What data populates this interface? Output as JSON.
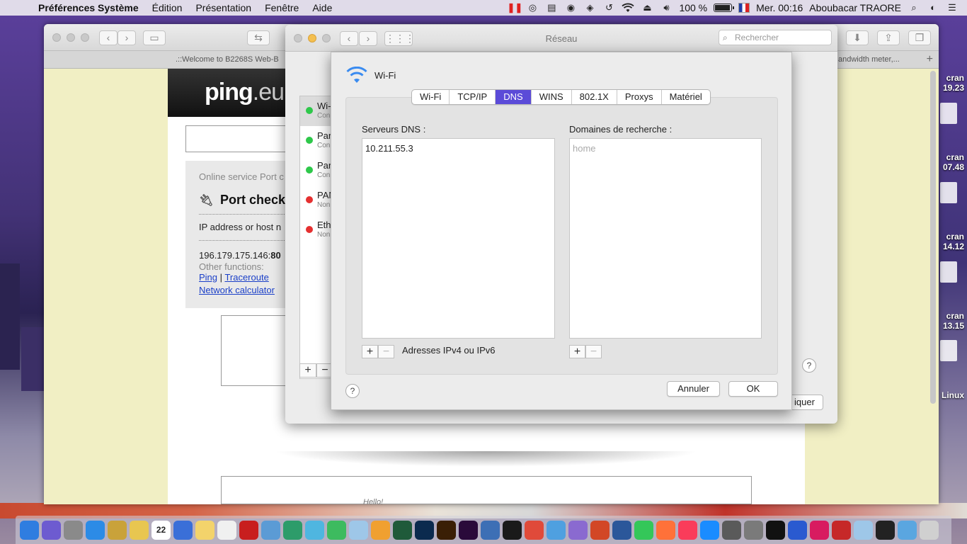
{
  "menubar": {
    "app_name": "Préférences Système",
    "menus": [
      "Édition",
      "Présentation",
      "Fenêtre",
      "Aide"
    ],
    "battery_pct": "100 %",
    "battery_level": 1.0,
    "clock": "Mer. 00:16",
    "user": "Aboubacar TRAORE"
  },
  "desktop": {
    "labels": [
      "cran\n19.23",
      "cran\n07.48",
      "cran\n14.12",
      "cran\n13.15",
      "Linux"
    ]
  },
  "browser": {
    "tab_left": ".::Welcome to B2268S Web-B",
    "tab_right": "andwidth meter,...",
    "page": {
      "logo_main": "ping",
      "logo_suffix": ".eu",
      "subtitle": "Online service Port c",
      "title": "Port check",
      "ip_label": "IP address or host n",
      "result_prefix": "196.179.175.146:",
      "result_bold": "80",
      "other_functions": "Other functions:",
      "link_ping": "Ping",
      "separator": "|",
      "link_traceroute": "Traceroute",
      "link_calculator": "Network calculator",
      "ad_text": "Hello!"
    }
  },
  "network_window": {
    "title": "Réseau",
    "search_placeholder": "Rechercher",
    "services": [
      {
        "name": "Wi-",
        "status": "Con",
        "color": "green"
      },
      {
        "name": "Para",
        "status": "Con",
        "color": "green"
      },
      {
        "name": "Para",
        "status": "Con",
        "color": "green"
      },
      {
        "name": "PAN",
        "status": "Non",
        "color": "red"
      },
      {
        "name": "Ethe",
        "status": "Non",
        "color": "red"
      }
    ],
    "apply_label": "iquer"
  },
  "dns_sheet": {
    "title": "Wi-Fi",
    "tabs": [
      "Wi-Fi",
      "TCP/IP",
      "DNS",
      "WINS",
      "802.1X",
      "Proxys",
      "Matériel"
    ],
    "active_tab": "DNS",
    "dns_servers_label": "Serveurs DNS :",
    "dns_servers": [
      "10.211.55.3"
    ],
    "search_domains_label": "Domaines de recherche :",
    "search_domains_placeholder": "home",
    "address_hint": "Adresses IPv4 ou IPv6",
    "cancel_label": "Annuler",
    "ok_label": "OK"
  },
  "colors": {
    "accent": "#5b4bd8",
    "green_status": "#2ec84a",
    "red_status": "#e53030"
  },
  "dock": {
    "icons": [
      "finder-icon",
      "siri-icon",
      "launchpad-icon",
      "safari-icon",
      "preview-icon",
      "notes-icon",
      "calendar-icon",
      "app-icon",
      "stickies-icon",
      "reminders-icon",
      "filezilla-icon",
      "utility-icon",
      "app-icon",
      "messages-icon",
      "android-icon",
      "eye-icon",
      "photos-icon",
      "audition-icon",
      "photoshop-icon",
      "illustrator-icon",
      "premiere-icon",
      "virtualbox-icon",
      "xcode-icon",
      "chrome-icon",
      "messages-icon",
      "app-icon",
      "powerpoint-icon",
      "word-icon",
      "facetime-icon",
      "firefox-icon",
      "music-icon",
      "appstore-icon",
      "app-icon",
      "system-preferences-icon",
      "terminal-icon",
      "app-icon",
      "app-icon",
      "app-icon",
      "eye-icon",
      "app-icon",
      "folder-icon",
      "trash-icon"
    ],
    "calendar_day": "22"
  }
}
